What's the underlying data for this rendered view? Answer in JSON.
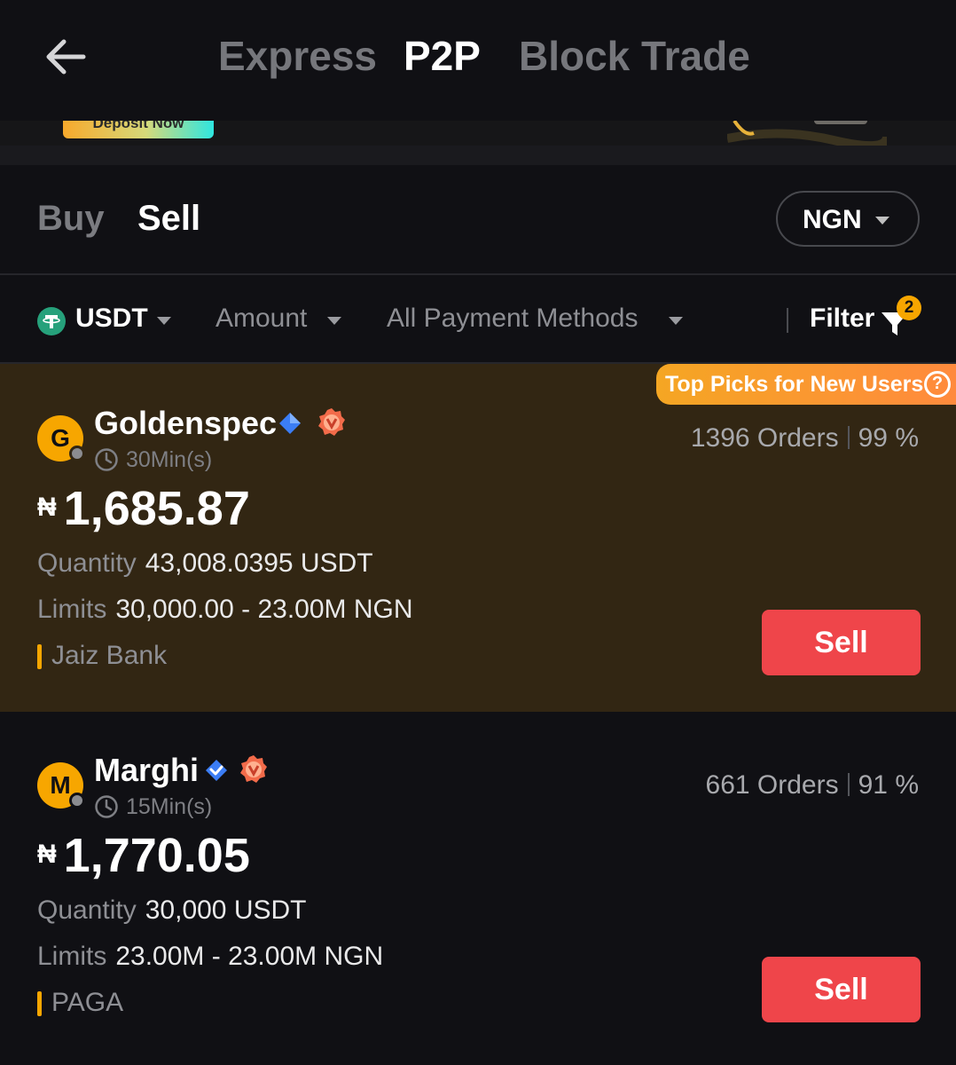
{
  "header": {
    "tabs": [
      {
        "label": "Express",
        "active": false
      },
      {
        "label": "P2P",
        "active": true
      },
      {
        "label": "Block Trade",
        "active": false
      }
    ]
  },
  "banner": {
    "deposit_label": "Deposit Now"
  },
  "trade_tabs": {
    "buy": "Buy",
    "sell": "Sell",
    "active": "Sell"
  },
  "fiat_selector": {
    "value": "NGN"
  },
  "filters": {
    "coin": "USDT",
    "amount": "Amount",
    "payment": "All Payment Methods",
    "filter_label": "Filter",
    "filter_count": "2"
  },
  "offers": [
    {
      "top_pick_label": "Top Picks for New Users",
      "avatar_letter": "G",
      "name": "Goldenspec",
      "time": "30Min(s)",
      "orders": "1396 Orders",
      "completion": "99 %",
      "currency_symbol": "₦",
      "price": "1,685.87",
      "quantity_label": "Quantity",
      "quantity": "43,008.0395 USDT",
      "limits_label": "Limits",
      "limits": "30,000.00 - 23.00M NGN",
      "payment_method": "Jaiz Bank",
      "action": "Sell"
    },
    {
      "avatar_letter": "M",
      "name": "Marghi",
      "time": "15Min(s)",
      "orders": "661 Orders",
      "completion": "91 %",
      "currency_symbol": "₦",
      "price": "1,770.05",
      "quantity_label": "Quantity",
      "quantity": "30,000 USDT",
      "limits_label": "Limits",
      "limits": "23.00M - 23.00M NGN",
      "payment_method": "PAGA",
      "action": "Sell"
    }
  ],
  "colors": {
    "background": "#101014",
    "highlight_card": "#322613",
    "sell_button": "#ef454a",
    "accent": "#f7a600"
  }
}
